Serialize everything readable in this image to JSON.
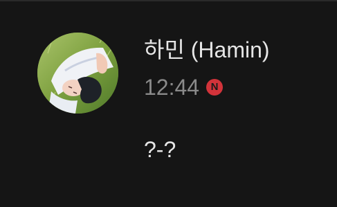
{
  "sender": {
    "name": "하민 (Hamin)",
    "avatar": "profile-photo"
  },
  "meta": {
    "time": "12:44",
    "badge_letter": "N",
    "badge_color": "#d2333a"
  },
  "message": {
    "text": "?-?"
  },
  "colors": {
    "background": "#151515",
    "primary_text": "#e6e6e6",
    "secondary_text": "#8a8a8a"
  }
}
